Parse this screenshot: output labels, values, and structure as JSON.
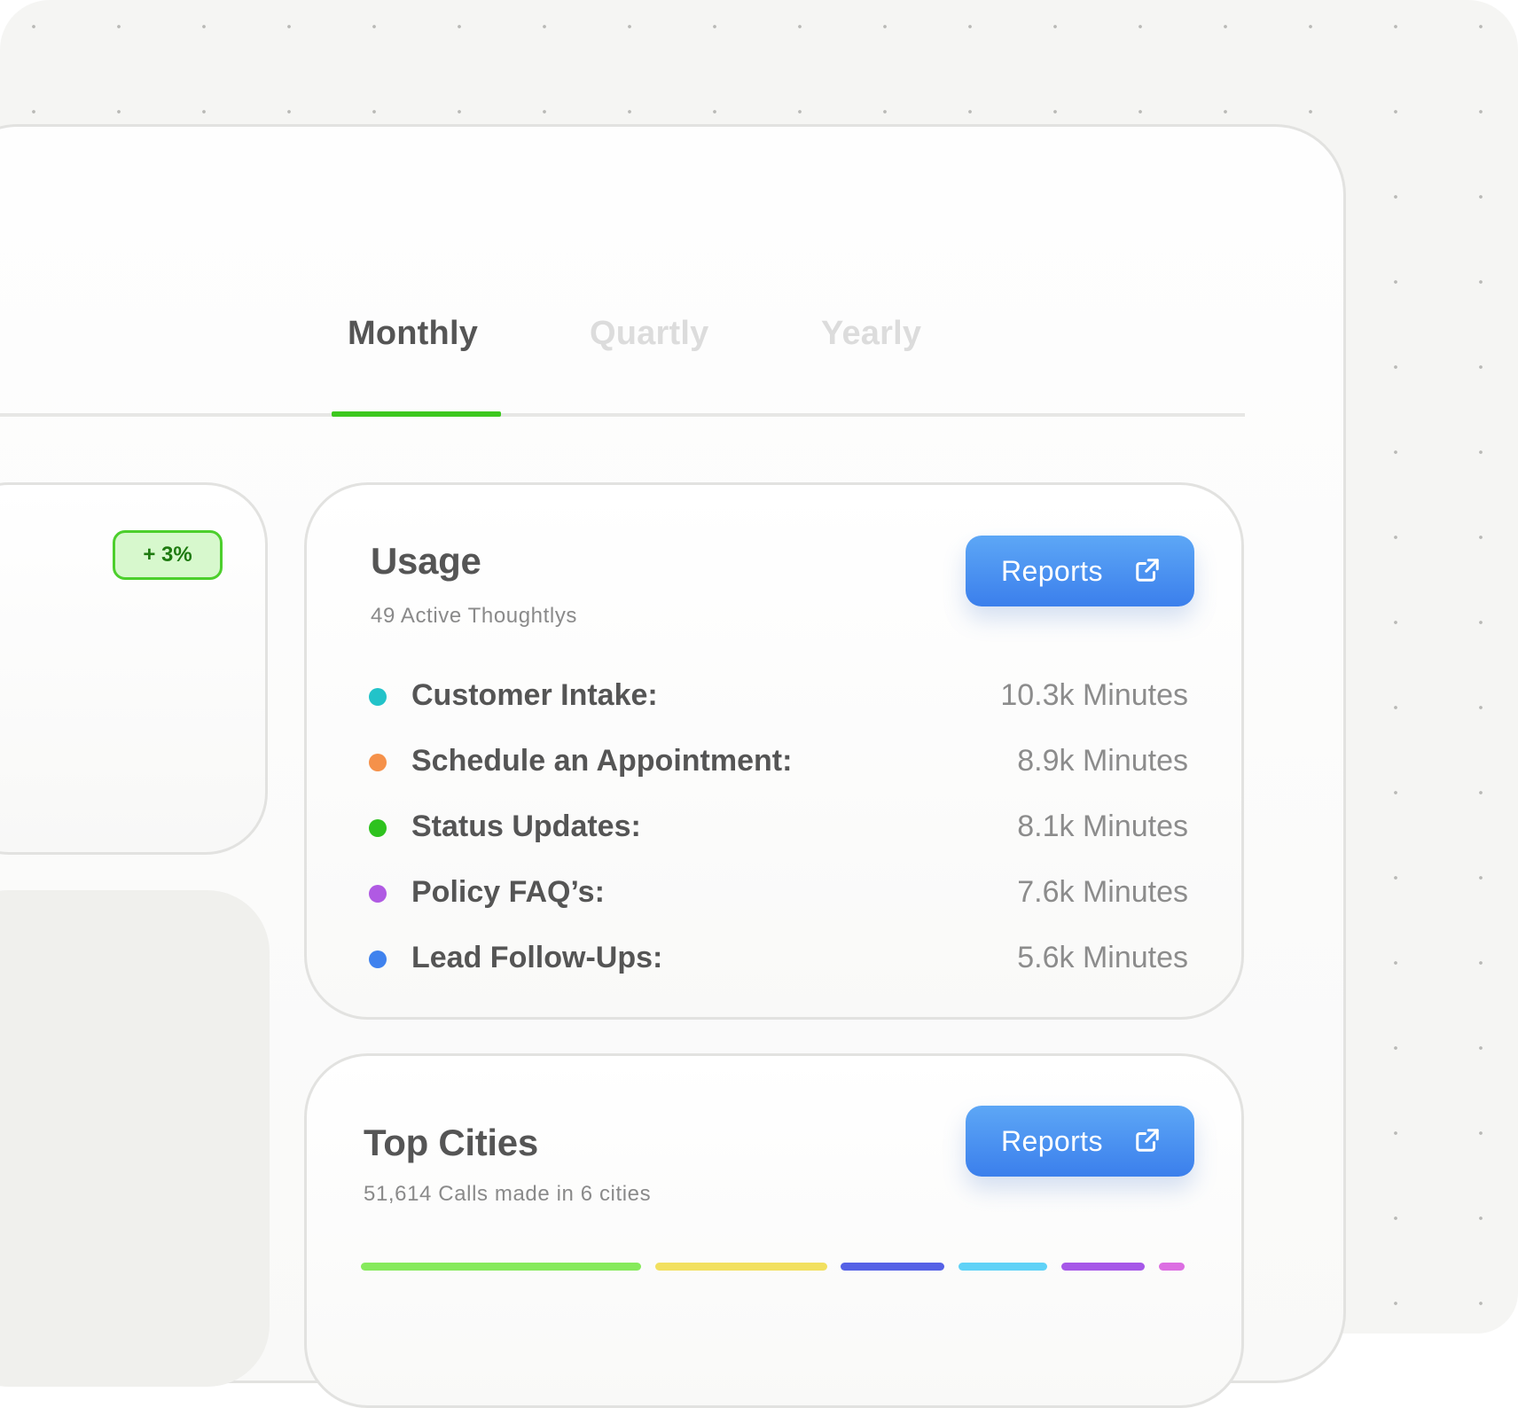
{
  "tabs": [
    {
      "label": "Monthly",
      "active": true
    },
    {
      "label": "Quartly",
      "active": false
    },
    {
      "label": "Yearly",
      "active": false
    }
  ],
  "left_card": {
    "badge": "+ 3%"
  },
  "usage": {
    "title": "Usage",
    "subtitle": "49 Active Thoughtlys",
    "button_label": "Reports",
    "items": [
      {
        "label": "Customer Intake:",
        "value": "10.3k Minutes",
        "color": "#22c3c9"
      },
      {
        "label": "Schedule an Appointment:",
        "value": "8.9k Minutes",
        "color": "#f5914a"
      },
      {
        "label": "Status Updates:",
        "value": "8.1k Minutes",
        "color": "#2ec21e"
      },
      {
        "label": "Policy FAQ’s:",
        "value": "7.6k Minutes",
        "color": "#b05ae3"
      },
      {
        "label": "Lead Follow-Ups:",
        "value": "5.6k Minutes",
        "color": "#3f82ee"
      }
    ]
  },
  "top_cities": {
    "title": "Top Cities",
    "subtitle": "51,614 Calls made in 6 cities",
    "button_label": "Reports",
    "bar_segments": [
      {
        "color": "#86ea5c"
      },
      {
        "color": "#f2e05f"
      },
      {
        "color": "#5561e6"
      },
      {
        "color": "#5fd2f7"
      },
      {
        "color": "#a657e8"
      },
      {
        "color": "#dc6ee2"
      }
    ]
  }
}
